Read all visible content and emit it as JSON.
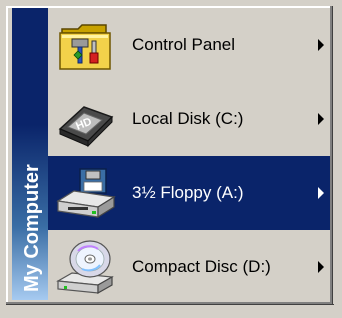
{
  "menu": {
    "banner_text": "My Computer",
    "items": [
      {
        "label": "Control Panel",
        "icon": "control-panel-icon",
        "selected": false
      },
      {
        "label": "Local Disk (C:)",
        "icon": "hard-disk-icon",
        "selected": false
      },
      {
        "label": "3½ Floppy (A:)",
        "icon": "floppy-drive-icon",
        "selected": true
      },
      {
        "label": "Compact Disc (D:)",
        "icon": "cd-drive-icon",
        "selected": false
      }
    ]
  },
  "colors": {
    "menu_background": "#d4d0c8",
    "selection": "#0a246a",
    "banner_top": "#0a246a",
    "banner_bottom": "#a6caf0"
  }
}
